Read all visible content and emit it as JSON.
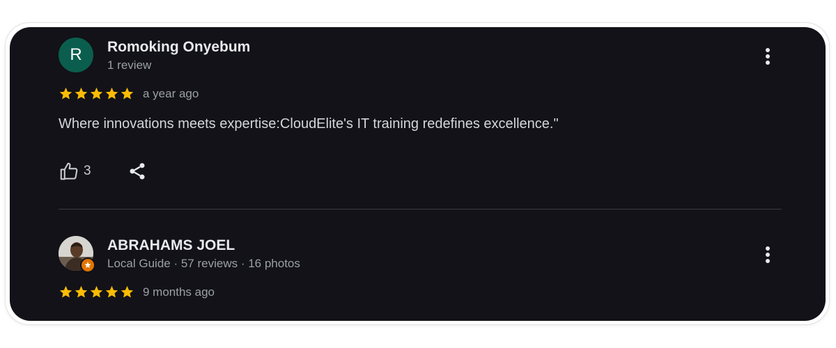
{
  "reviews": [
    {
      "avatar_letter": "R",
      "avatar_color": "#0b5e4d",
      "author_name": "Romoking Onyebum",
      "author_meta": "1 review",
      "rating": 5,
      "time": "a year ago",
      "text": "Where innovations meets expertise:CloudElite's IT training redefines excellence.\"",
      "likes": "3",
      "icons": {
        "more": "more-vert-icon",
        "like": "thumb-up-icon",
        "share": "share-icon"
      }
    },
    {
      "avatar_image": "profile-photo",
      "author_name": "ABRAHAMS JOEL",
      "author_meta": "Local Guide · 57 reviews · 16 photos",
      "rating": 5,
      "time": "9 months ago",
      "icons": {
        "more": "more-vert-icon",
        "badge": "local-guide-badge-icon"
      }
    }
  ],
  "colors": {
    "card_background": "#121218",
    "star": "#fbbc04",
    "badge": "#e37400"
  }
}
